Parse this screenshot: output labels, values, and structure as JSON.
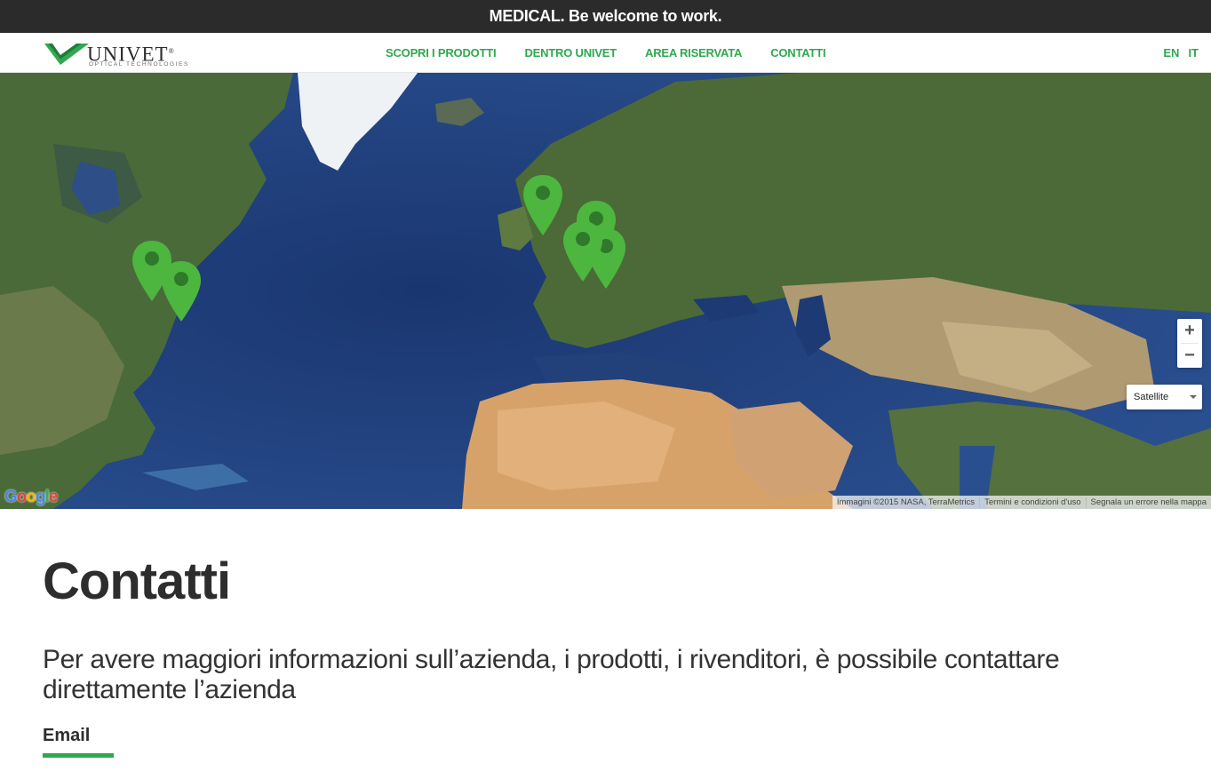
{
  "topbar": {
    "tagline": "MEDICAL. Be welcome to work."
  },
  "brand": {
    "name": "UNIVET",
    "registered": "®",
    "subtitle": "OPTICAL TECHNOLOGIES"
  },
  "nav": {
    "items": [
      {
        "label": "SCOPRI I PRODOTTI"
      },
      {
        "label": "DENTRO UNIVET"
      },
      {
        "label": "AREA RISERVATA"
      },
      {
        "label": "CONTATTI"
      }
    ]
  },
  "languages": [
    {
      "label": "EN"
    },
    {
      "label": "IT"
    }
  ],
  "map": {
    "zoom_in": "+",
    "zoom_out": "−",
    "map_type": "Satellite",
    "google": "Google",
    "attribution": [
      "Immagini ©2015 NASA, TerraMetrics",
      "Termini e condizioni d'uso",
      "Segnala un errore nella mappa"
    ],
    "colors": {
      "pin": "#4cb63f",
      "ocean": "#1f3d78"
    }
  },
  "content": {
    "title": "Contatti",
    "intro": "Per avere maggiori informazioni sull’azienda, i prodotti, i rivenditori, è possibile contattare direttamente l’azienda",
    "section_label": "Email"
  },
  "colors": {
    "accent": "#2fa84f",
    "topbar": "#2b2b2b",
    "text": "#2d2d2d"
  }
}
